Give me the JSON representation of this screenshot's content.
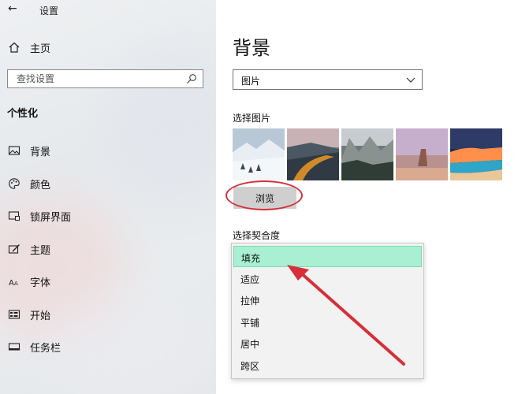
{
  "window": {
    "title": "设置",
    "back_icon": "arrow-left-icon"
  },
  "sidebar": {
    "home_label": "主页",
    "search_placeholder": "查找设置",
    "section_title": "个性化",
    "items": [
      {
        "label": "背景",
        "icon": "picture-icon"
      },
      {
        "label": "颜色",
        "icon": "palette-icon"
      },
      {
        "label": "锁屏界面",
        "icon": "lock-screen-icon"
      },
      {
        "label": "主题",
        "icon": "brush-icon"
      },
      {
        "label": "字体",
        "icon": "font-icon"
      },
      {
        "label": "开始",
        "icon": "start-icon"
      },
      {
        "label": "任务栏",
        "icon": "taskbar-icon"
      }
    ]
  },
  "main": {
    "title": "背景",
    "background_select": {
      "value": "图片"
    },
    "choose_picture_label": "选择图片",
    "browse_label": "浏览",
    "fit_label": "选择契合度",
    "fit_options": [
      "填充",
      "适应",
      "拉伸",
      "平铺",
      "居中",
      "跨区"
    ],
    "fit_selected": "填充"
  },
  "colors": {
    "accent_highlight": "#a9f0d2",
    "annotation_red": "#d62f3a"
  }
}
